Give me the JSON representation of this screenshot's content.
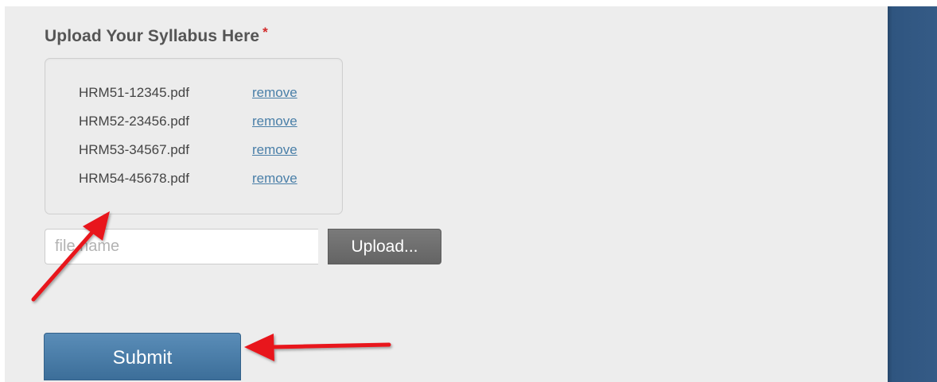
{
  "form": {
    "heading": "Upload Your Syllabus Here",
    "required_marker": "*",
    "files": [
      {
        "name": "HRM51-12345.pdf",
        "action": "remove"
      },
      {
        "name": "HRM52-23456.pdf",
        "action": "remove"
      },
      {
        "name": "HRM53-34567.pdf",
        "action": "remove"
      },
      {
        "name": "HRM54-45678.pdf",
        "action": "remove"
      }
    ],
    "file_input_placeholder": "file name",
    "upload_label": "Upload...",
    "submit_label": "Submit"
  },
  "annotations": {
    "arrow_color": "#e8161b"
  },
  "colors": {
    "background": "#ededed",
    "link": "#4a7fa8",
    "submit": "#4a7ea9",
    "upload": "#6e6e6e",
    "side_panel": "#345a85",
    "required": "#d22b2b"
  }
}
